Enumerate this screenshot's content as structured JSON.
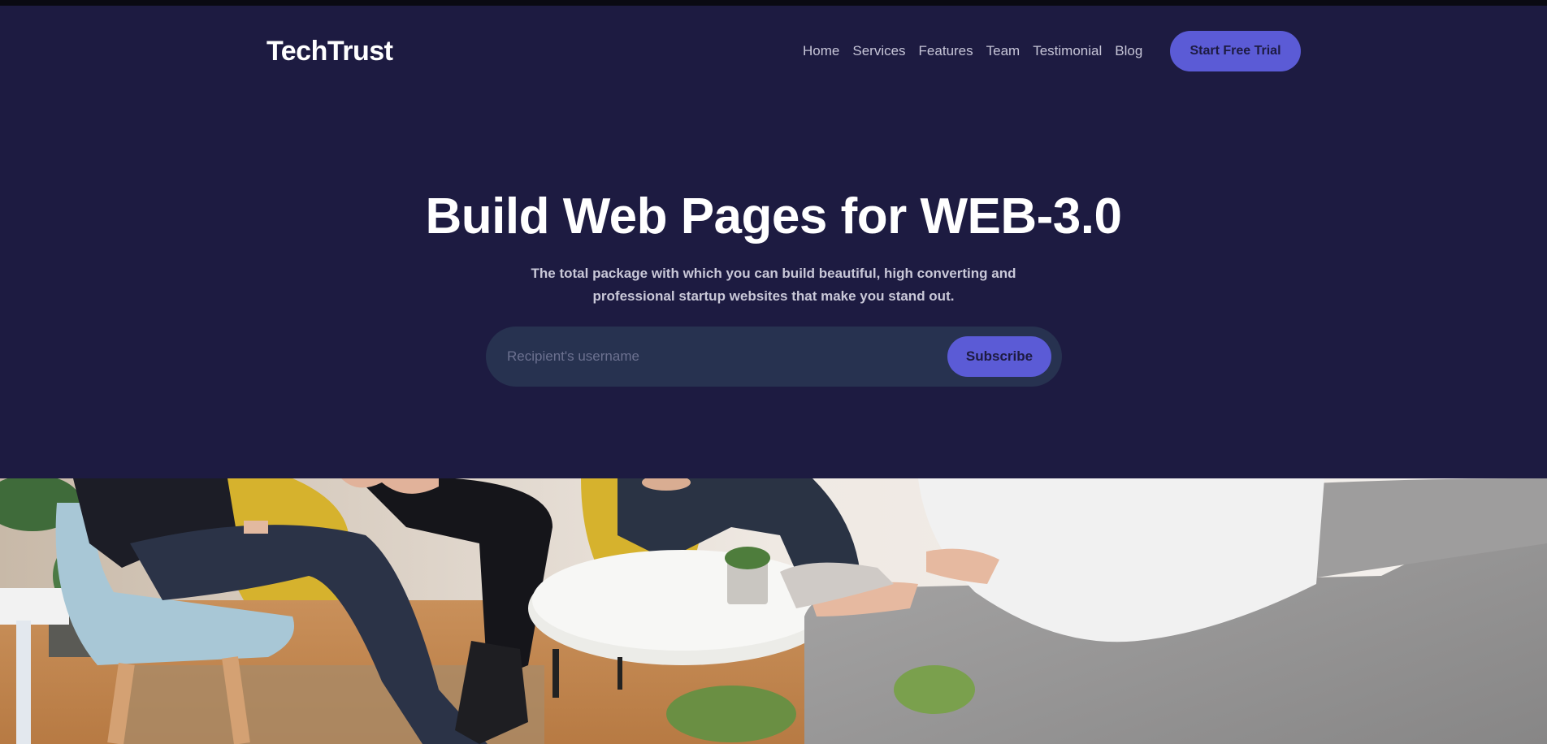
{
  "brand": {
    "name": "TechTrust"
  },
  "nav": {
    "items": [
      {
        "label": "Home"
      },
      {
        "label": "Services"
      },
      {
        "label": "Features"
      },
      {
        "label": "Team"
      },
      {
        "label": "Testimonial"
      },
      {
        "label": "Blog"
      }
    ],
    "cta_label": "Start Free Trial"
  },
  "hero": {
    "title": "Build Web Pages for WEB-3.0",
    "subtitle_line1": "The total package with which you can build beautiful, high converting and",
    "subtitle_line2": "professional startup websites that make you stand out."
  },
  "subscribe": {
    "placeholder": "Recipient's username",
    "button_label": "Subscribe"
  },
  "image": {
    "description_icon": "team-meeting-photo"
  },
  "colors": {
    "background": "#1d1b41",
    "accent": "#5b5bd6",
    "input_bg": "#273250"
  }
}
